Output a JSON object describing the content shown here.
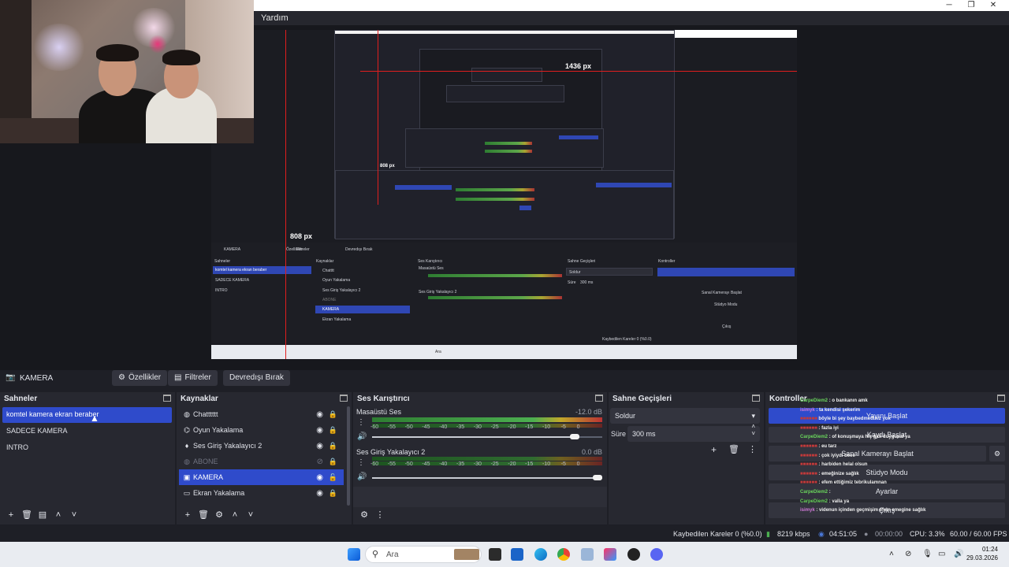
{
  "window": {
    "menu_help": "Yardım"
  },
  "preview": {
    "width_label": "1436 px",
    "height_label": "808 px",
    "height_label_small": "808 px",
    "nested_scene_text": "komtel kamera ekran beraber",
    "nested_sahneler": "Sahneler",
    "nested_kaynaklar": "Kaynaklar",
    "nested_kamera": "KAMERA",
    "nested_filtreler": "Filtreler",
    "nested_ozellikler": "Özellikler",
    "nested_devredisi": "Devredışı Bırak",
    "nested_ses": "Ses Karıştırıcı",
    "nested_sahne_gecis": "Sahne Geçişleri",
    "nested_kontroller": "Kontroller",
    "nested_sadece": "SADECE KAMERA",
    "nested_intro": "INTRO",
    "nested_soldur": "Soldur",
    "nested_sure": "Süre",
    "nested_ms": "300 ms",
    "nested_sanal": "Sanal Kamerayı Başlat",
    "nested_studyo": "Stüdyo Modu",
    "nested_cikis": "Çıkış",
    "nested_masaustu": "Masaüstü Ses",
    "nested_ses_giris": "Ses Giriş Yakalayıcı 2",
    "nested_chattt": "Chatttt",
    "nested_oyun": "Oyun Yakalama",
    "nested_abone": "ABONE",
    "nested_ekran": "Ekran Yakalama",
    "nested_status": "Kaybedilen Kareler 0 (%0.0)",
    "nested_ara": "Ara"
  },
  "toolbar": {
    "source_name": "KAMERA",
    "properties": "Özellikler",
    "filters": "Filtreler",
    "deactivate": "Devredışı Bırak"
  },
  "scenes": {
    "title": "Sahneler",
    "items": [
      "komtel kamera ekran beraber",
      "SADECE KAMERA",
      "INTRO"
    ]
  },
  "sources": {
    "title": "Kaynaklar",
    "items": [
      {
        "label": "Chatttttt",
        "icon": "globe-icon"
      },
      {
        "label": "Oyun Yakalama",
        "icon": "gamepad-icon"
      },
      {
        "label": "Ses Giriş Yakalayıcı 2",
        "icon": "microphone-icon"
      },
      {
        "label": "ABONE",
        "icon": "globe-icon"
      },
      {
        "label": "KAMERA",
        "icon": "camera-icon"
      },
      {
        "label": "Ekran Yakalama",
        "icon": "monitor-icon"
      }
    ]
  },
  "mixer": {
    "title": "Ses Karıştırıcı",
    "channels": [
      {
        "name": "Masaüstü Ses",
        "db": "-12.0 dB",
        "volume": 0.9
      },
      {
        "name": "Ses Giriş Yakalayıcı 2",
        "db": "0.0 dB",
        "volume": 1.0
      }
    ],
    "scale": [
      "-60",
      "-55",
      "-50",
      "-45",
      "-40",
      "-35",
      "-30",
      "-25",
      "-20",
      "-15",
      "-10",
      "-5",
      "0"
    ]
  },
  "transitions": {
    "title": "Sahne Geçişleri",
    "selected": "Soldur",
    "duration_label": "Süre",
    "duration_value": "300 ms"
  },
  "controls": {
    "title": "Kontroller",
    "buttons": [
      "Yayını Başlat",
      "Kaydı Başlat",
      "Sanal Kamerayı Başlat",
      "Stüdyo Modu",
      "Ayarlar",
      "Çıkış"
    ],
    "chat": [
      {
        "user": "CarpeDiem2",
        "text": ": o bankanın amk",
        "color": "u1"
      },
      {
        "user": "isimyk",
        "text": ": ta kendisi şekerim",
        "color": "u3"
      },
      {
        "user": "",
        "text": "böyle bi şey baybedmediniz yok",
        "color": "u2"
      },
      {
        "user": "",
        "text": ": fazla iyi",
        "color": "u2"
      },
      {
        "user": "CarpeDiem2",
        "text": ": of konuşmaya hiç gidi duygusal ya",
        "color": "u1"
      },
      {
        "user": "",
        "text": ": eu tarz",
        "color": "u2"
      },
      {
        "user": "",
        "text": ": çok iyiydi beee",
        "color": "u2"
      },
      {
        "user": "",
        "text": ": harbiden helal olsun",
        "color": "u2"
      },
      {
        "user": "",
        "text": ": emeğinize sağlık",
        "color": "u2"
      },
      {
        "user": "",
        "text": ": efem ettiğimiz tebrikulamnan",
        "color": "u2"
      },
      {
        "user": "CarpeDiem2",
        "text": ":",
        "color": "u1"
      },
      {
        "user": "CarpeDiem2",
        "text": ": valla ya",
        "color": "u1"
      },
      {
        "user": "isimyk",
        "text": ": videnun içinden geçmişim efem emegine sağlık",
        "color": "u3"
      }
    ]
  },
  "status": {
    "dropped": "Kaybedilen Kareler 0 (%0.0)",
    "bitrate": "8219 kbps",
    "stream_time": "04:51:05",
    "record_time": "00:00:00",
    "cpu": "CPU: 3.3%",
    "fps": "60.00 / 60.00 FPS"
  },
  "taskbar": {
    "search": "Ara",
    "time": "01:24",
    "date": "29.03.2026"
  },
  "colors": {
    "accent": "#2f4bcb",
    "panel": "#272830",
    "background": "#1e1f26",
    "red_guide": "#e01e1e"
  }
}
